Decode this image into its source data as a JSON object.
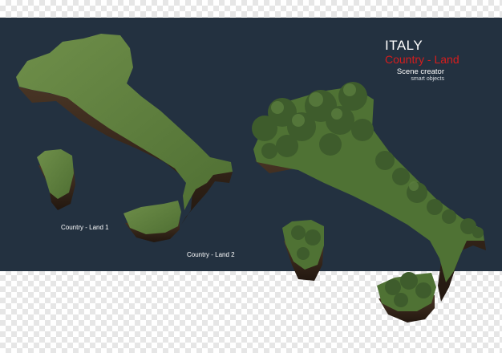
{
  "header": {
    "title": "ITALY",
    "subtitle": "Country - Land",
    "caption": "Scene creator",
    "caption_small": "smart objects"
  },
  "labels": {
    "land1": "Country - Land 1",
    "land2": "Country - Land 2"
  },
  "colors": {
    "panel_bg": "#233140",
    "title_red": "#d61d1d",
    "grass": "#5d7f3e",
    "soil": "#3a2a1e",
    "trees": "#3e5c2c"
  }
}
